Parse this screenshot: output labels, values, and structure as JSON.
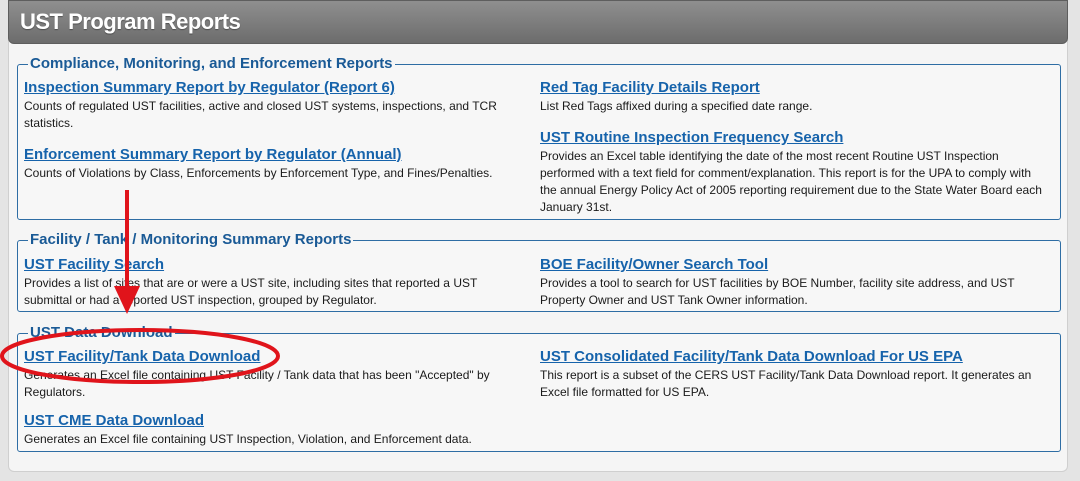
{
  "page_title": "UST Program Reports",
  "colors": {
    "link": "#1663ab",
    "section_title": "#1a5a96",
    "annotation": "#e0141b",
    "header": "#7a7a7a"
  },
  "sections": {
    "compliance": {
      "title": "Compliance, Monitoring, and Enforcement Reports",
      "reports": [
        {
          "title": "Inspection Summary Report by Regulator (Report 6)",
          "description": "Counts of regulated UST facilities, active and closed UST systems, inspections, and TCR statistics."
        },
        {
          "title": "Enforcement Summary Report by Regulator (Annual)",
          "description": "Counts of Violations by Class, Enforcements by Enforcement Type, and Fines/Penalties."
        },
        {
          "title": "Red Tag Facility Details Report",
          "description": "List Red Tags affixed during a specified date range."
        },
        {
          "title": "UST Routine Inspection Frequency Search",
          "description": "Provides an Excel table identifying the date of the most recent Routine UST Inspection performed with a text field for comment/explanation. This report is for the UPA to comply with the annual Energy Policy Act of 2005 reporting requirement due to the State Water Board each January 31st."
        }
      ]
    },
    "facility": {
      "title": "Facility / Tank / Monitoring Summary Reports",
      "reports": [
        {
          "title": "UST Facility Search",
          "description": "Provides a list of sites that are or were a UST site, including sites that reported a UST submittal or had a reported UST inspection, grouped by Regulator."
        },
        {
          "title": "BOE Facility/Owner Search Tool",
          "description": "Provides a tool to search for UST facilities by BOE Number, facility site address, and UST Property Owner and UST Tank Owner information."
        }
      ]
    },
    "download": {
      "title": "UST Data Download",
      "reports": [
        {
          "title": "UST Facility/Tank Data Download",
          "description": "Generates an Excel file containing UST Facility / Tank data that has been \"Accepted\" by Regulators."
        },
        {
          "title": "UST CME Data Download",
          "description": "Generates an Excel file containing UST Inspection, Violation, and Enforcement data."
        },
        {
          "title": "UST Consolidated Facility/Tank Data Download For US EPA",
          "description": "This report is a subset of the CERS UST Facility/Tank Data Download report. It generates an Excel file formatted for US EPA."
        }
      ]
    }
  }
}
